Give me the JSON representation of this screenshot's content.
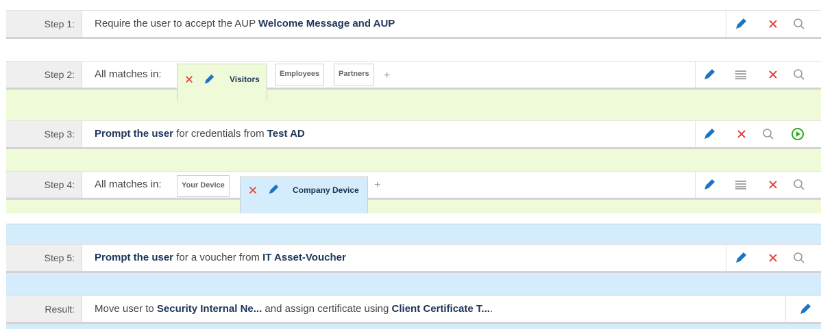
{
  "steps": {
    "step1": {
      "label": "Step 1:",
      "text_prefix": "Require the user to accept the AUP ",
      "text_strong": "Welcome Message and AUP"
    },
    "step2": {
      "label": "Step 2:",
      "matches_label": "All matches in:",
      "tabs": [
        "Visitors",
        "Employees",
        "Partners"
      ],
      "add_label": "+"
    },
    "step3": {
      "label": "Step 3:",
      "text_strong1": "Prompt the user",
      "text_mid": " for credentials from ",
      "text_strong2": "Test AD"
    },
    "step4": {
      "label": "Step 4:",
      "matches_label": "All matches in:",
      "tabs": [
        "Your Device",
        "Company Device"
      ],
      "add_label": "+"
    },
    "step5": {
      "label": "Step 5:",
      "text_strong1": "Prompt the user",
      "text_mid": " for a voucher from ",
      "text_strong2": "IT Asset-Voucher"
    }
  },
  "result": {
    "label": "Result:",
    "part1": "Move user to ",
    "strong1": "Security Internal Ne...",
    "part2": " and assign certificate using ",
    "strong2": "Client Certificate T...",
    "part3": "."
  },
  "icons": {
    "edit": "pencil-icon",
    "delete": "close-icon",
    "search": "search-icon",
    "list": "list-icon",
    "run": "play-circle-icon"
  },
  "colors": {
    "edit_blue": "#1d74c4",
    "delete_red": "#e0453a",
    "run_green": "#2eaa1f",
    "green_band": "#effad8",
    "blue_band": "#d4ecfb",
    "strong_text": "#1d3557"
  }
}
